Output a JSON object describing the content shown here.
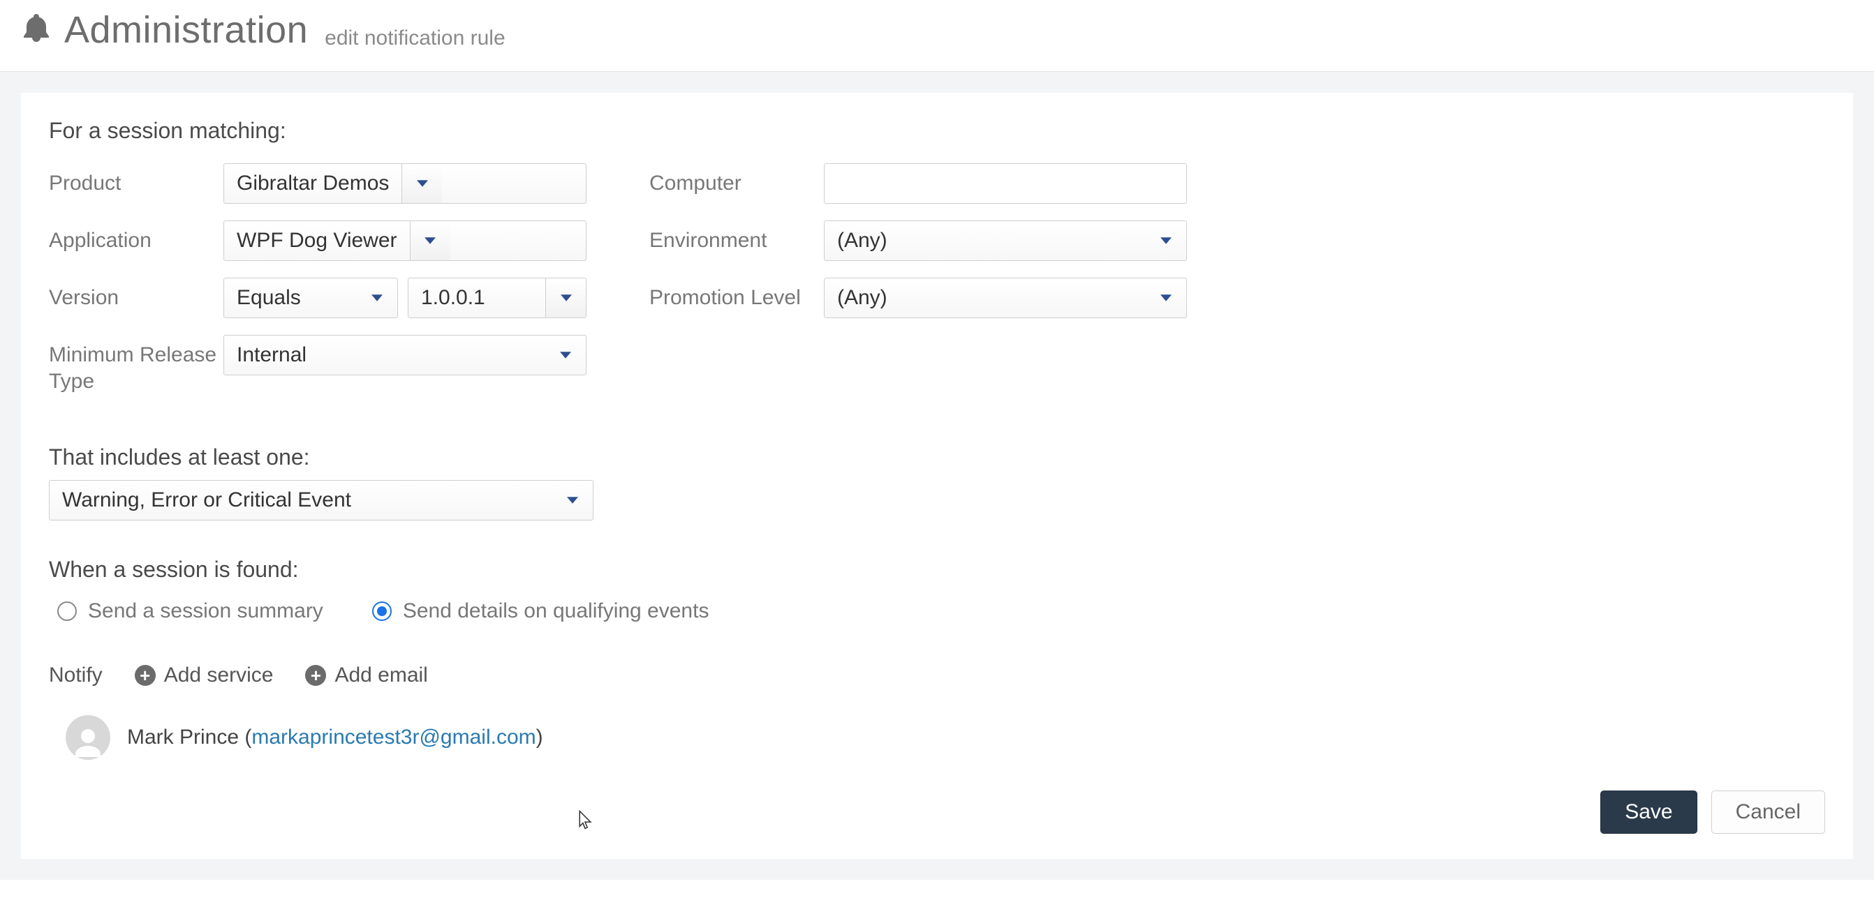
{
  "header": {
    "title": "Administration",
    "subtitle": "edit notification rule"
  },
  "section_matching": {
    "heading": "For a session matching:",
    "product_label": "Product",
    "product_value": "Gibraltar Demos",
    "application_label": "Application",
    "application_value": "WPF Dog Viewer",
    "version_label": "Version",
    "version_op": "Equals",
    "version_value": "1.0.0.1",
    "min_release_label": "Minimum Release Type",
    "min_release_value": "Internal",
    "computer_label": "Computer",
    "computer_value": "",
    "environment_label": "Environment",
    "environment_value": "(Any)",
    "promotion_label": "Promotion Level",
    "promotion_value": "(Any)"
  },
  "section_includes": {
    "heading": "That includes at least one:",
    "value": "Warning, Error or Critical Event"
  },
  "section_found": {
    "heading": "When a session is found:",
    "option_summary": "Send a session summary",
    "option_details": "Send details on qualifying events",
    "selected": "details"
  },
  "notify": {
    "label": "Notify",
    "add_service": "Add service",
    "add_email": "Add email",
    "recipient_name": "Mark Prince",
    "recipient_email": "markaprincetest3r@gmail.com"
  },
  "footer": {
    "save": "Save",
    "cancel": "Cancel"
  }
}
